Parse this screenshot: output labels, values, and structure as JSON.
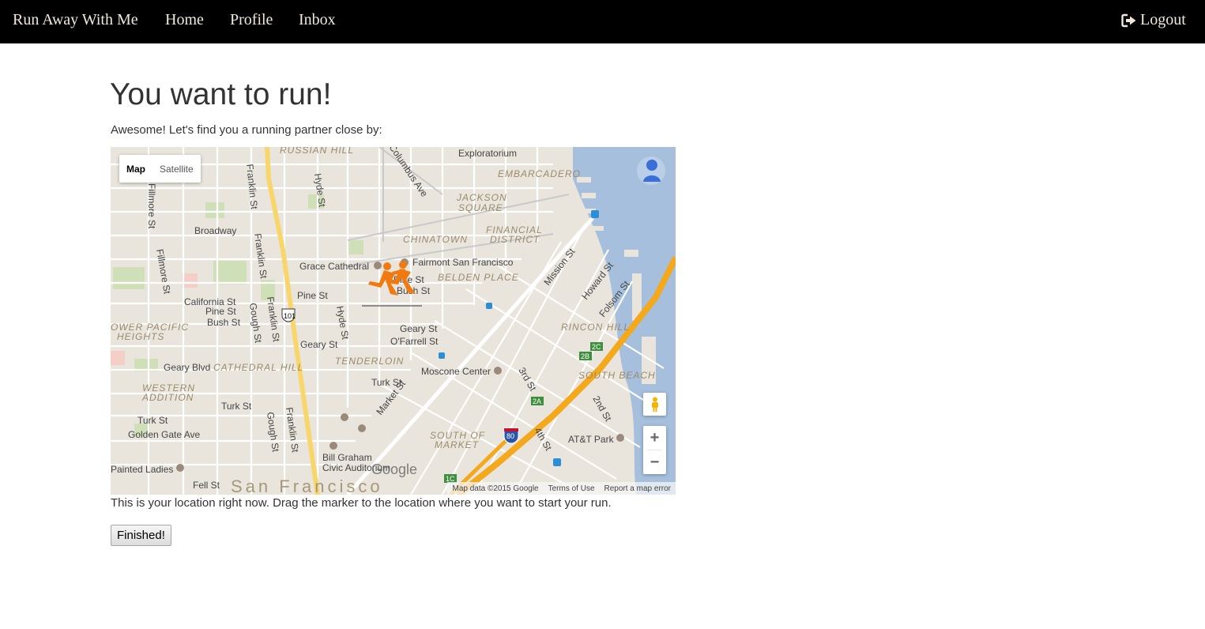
{
  "nav": {
    "brand": "Run Away With Me",
    "home": "Home",
    "profile": "Profile",
    "inbox": "Inbox",
    "logout": "Logout"
  },
  "page": {
    "title": "You want to run!",
    "intro": "Awesome! Let's find you a running partner close by:",
    "caption": "This is your location right now. Drag the marker to the location where you want to start your run.",
    "finished_button": "Finished!"
  },
  "map": {
    "type_map": "Map",
    "type_satellite": "Satellite",
    "zoom_in": "+",
    "zoom_out": "−",
    "google_logo": "Google",
    "attribution": "Map data ©2015 Google",
    "terms": "Terms of Use",
    "report": "Report a map error",
    "city": "San Francisco",
    "labels": {
      "russian_hill": "RUSSIAN HILL",
      "exploratorium": "Exploratorium",
      "embarcadero": "EMBARCADERO",
      "jackson_square": "JACKSON",
      "jackson_square_2": "SQUARE",
      "chinatown": "CHINATOWN",
      "financial": "FINANCIAL",
      "financial_2": "DISTRICT",
      "grace": "Grace Cathedral",
      "fairmont": "Fairmont San Francisco",
      "belden": "BELDEN PLACE",
      "broadway": "Broadway",
      "california": "California St",
      "pine": "Pine St",
      "bush": "Bush St",
      "geary": "Geary St",
      "ofarrell": "O'Farrell St",
      "geary_blvd": "Geary Blvd",
      "cathedral_hill": "CATHEDRAL HILL",
      "tenderloin": "TENDERLOIN",
      "western": "WESTERN",
      "western_2": "ADDITION",
      "turk": "Turk St",
      "golden_gate": "Golden Gate Ave",
      "moscone": "Moscone Center",
      "rincon": "RINCON HILL",
      "south_beach": "SOUTH BEACH",
      "soma": "SOUTH OF",
      "soma_2": "MARKET",
      "att": "AT&T Park",
      "bill_graham": "Bill Graham",
      "bill_graham_2": "Civic Auditorium",
      "painted": "Painted Ladies",
      "fell": "Fell St",
      "lower_pacific": "OWER PACIFIC",
      "lower_pacific_2": "HEIGHTS",
      "fillmore": "Fillmore St",
      "franklin": "Franklin St",
      "gough": "Gough St",
      "hyde": "Hyde St",
      "mission": "Mission St",
      "howard": "Howard St",
      "folsom": "Folsom St",
      "market": "Market St",
      "third": "3rd St",
      "fourth": "4th St",
      "second": "2nd St",
      "columbus": "Columbus Ave",
      "hwy_101": "101",
      "i80": "80",
      "exit_2c": "2C",
      "exit_2b": "2B",
      "exit_2a": "2A",
      "exit_1c": "1C"
    }
  },
  "colors": {
    "navbar_bg": "#000000",
    "nav_text": "#f0e8dc",
    "water": "#a5bfdd",
    "highway": "#f4a81c",
    "marker": "#f07a10"
  }
}
